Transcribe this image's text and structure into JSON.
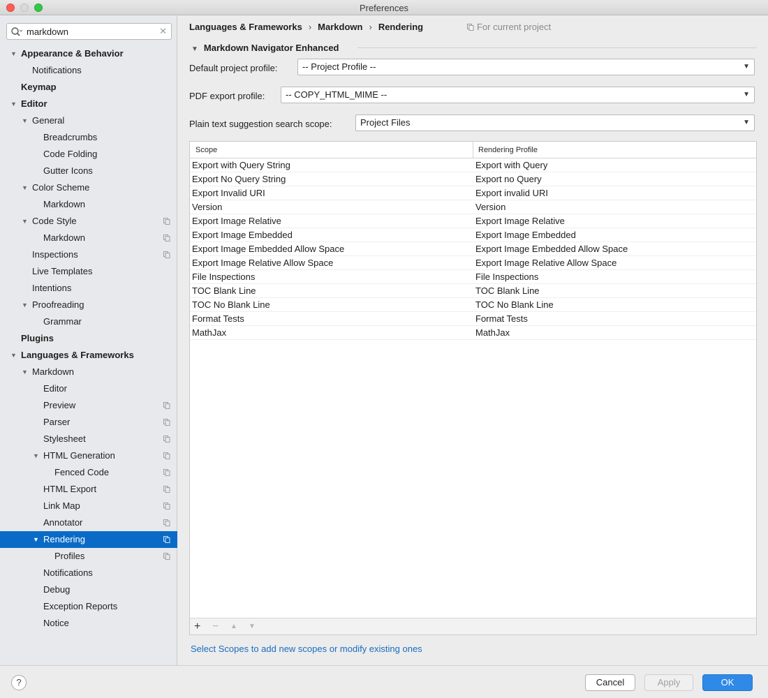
{
  "window": {
    "title": "Preferences"
  },
  "search": {
    "value": "markdown"
  },
  "sidebar": {
    "items": [
      {
        "label": "Appearance & Behavior",
        "level": 0,
        "bold": true,
        "expanded": true,
        "project": false
      },
      {
        "label": "Notifications",
        "level": 1,
        "bold": false,
        "project": false
      },
      {
        "label": "Keymap",
        "level": 0,
        "bold": true,
        "project": false
      },
      {
        "label": "Editor",
        "level": 0,
        "bold": true,
        "expanded": true,
        "project": false
      },
      {
        "label": "General",
        "level": 1,
        "expanded": true,
        "project": false
      },
      {
        "label": "Breadcrumbs",
        "level": 2,
        "project": false
      },
      {
        "label": "Code Folding",
        "level": 2,
        "project": false
      },
      {
        "label": "Gutter Icons",
        "level": 2,
        "project": false
      },
      {
        "label": "Color Scheme",
        "level": 1,
        "expanded": true,
        "project": false
      },
      {
        "label": "Markdown",
        "level": 2,
        "project": false
      },
      {
        "label": "Code Style",
        "level": 1,
        "expanded": true,
        "project": true
      },
      {
        "label": "Markdown",
        "level": 2,
        "project": true
      },
      {
        "label": "Inspections",
        "level": 1,
        "project": true
      },
      {
        "label": "Live Templates",
        "level": 1,
        "project": false
      },
      {
        "label": "Intentions",
        "level": 1,
        "project": false
      },
      {
        "label": "Proofreading",
        "level": 1,
        "expanded": true,
        "project": false
      },
      {
        "label": "Grammar",
        "level": 2,
        "project": false
      },
      {
        "label": "Plugins",
        "level": 0,
        "bold": true,
        "project": false
      },
      {
        "label": "Languages & Frameworks",
        "level": 0,
        "bold": true,
        "expanded": true,
        "project": false
      },
      {
        "label": "Markdown",
        "level": 1,
        "expanded": true,
        "project": false
      },
      {
        "label": "Editor",
        "level": 2,
        "project": false
      },
      {
        "label": "Preview",
        "level": 2,
        "project": true
      },
      {
        "label": "Parser",
        "level": 2,
        "project": true
      },
      {
        "label": "Stylesheet",
        "level": 2,
        "project": true
      },
      {
        "label": "HTML Generation",
        "level": 2,
        "expanded": true,
        "project": true
      },
      {
        "label": "Fenced Code",
        "level": 3,
        "project": true
      },
      {
        "label": "HTML Export",
        "level": 2,
        "project": true
      },
      {
        "label": "Link Map",
        "level": 2,
        "project": true
      },
      {
        "label": "Annotator",
        "level": 2,
        "project": true
      },
      {
        "label": "Rendering",
        "level": 2,
        "expanded": true,
        "selected": true,
        "project": true
      },
      {
        "label": "Profiles",
        "level": 3,
        "project": true
      },
      {
        "label": "Notifications",
        "level": 2,
        "project": false
      },
      {
        "label": "Debug",
        "level": 2,
        "project": false
      },
      {
        "label": "Exception Reports",
        "level": 2,
        "project": false
      },
      {
        "label": "Notice",
        "level": 2,
        "project": false
      }
    ]
  },
  "breadcrumb": {
    "items": [
      "Languages & Frameworks",
      "Markdown",
      "Rendering"
    ],
    "separator": "›",
    "for_project": "For current project"
  },
  "section": {
    "title": "Markdown Navigator Enhanced"
  },
  "fields": {
    "default_profile": {
      "label": "Default project profile:",
      "value": "-- Project Profile --"
    },
    "pdf_profile": {
      "label": "PDF export profile:",
      "value": "-- COPY_HTML_MIME --"
    },
    "search_scope": {
      "label": "Plain text suggestion search scope:",
      "value": "Project Files"
    }
  },
  "table": {
    "headers": [
      "Scope",
      "Rendering Profile"
    ],
    "rows": [
      [
        "Export with Query String",
        "Export with Query"
      ],
      [
        "Export No Query String",
        "Export no Query"
      ],
      [
        "Export Invalid URI",
        "Export invalid URI"
      ],
      [
        "Version",
        "Version"
      ],
      [
        "Export Image Relative",
        "Export Image Relative"
      ],
      [
        "Export Image Embedded",
        "Export Image Embedded"
      ],
      [
        "Export Image Embedded Allow Space",
        "Export Image Embedded Allow Space"
      ],
      [
        "Export Image Relative Allow Space",
        "Export Image Relative Allow Space"
      ],
      [
        "File Inspections",
        "File Inspections"
      ],
      [
        "TOC Blank Line",
        "TOC Blank Line"
      ],
      [
        "TOC No Blank Line",
        "TOC No Blank Line"
      ],
      [
        "Format Tests",
        "Format Tests"
      ],
      [
        "MathJax",
        "MathJax"
      ]
    ],
    "toolbar": {
      "add": "+",
      "remove": "−",
      "up": "▲",
      "down": "▼"
    }
  },
  "link": {
    "text": "Select Scopes to add new scopes or modify existing ones"
  },
  "footer": {
    "help": "?",
    "cancel": "Cancel",
    "apply": "Apply",
    "ok": "OK"
  },
  "colors": {
    "accent": "#0a6bc7",
    "ok_button": "#2e8ae6",
    "link": "#1a6cbf"
  },
  "icons": {
    "search": "search-icon",
    "clear": "clear-icon",
    "project": "project-scope-icon",
    "expand": "triangle-down-icon",
    "help": "help-icon"
  }
}
